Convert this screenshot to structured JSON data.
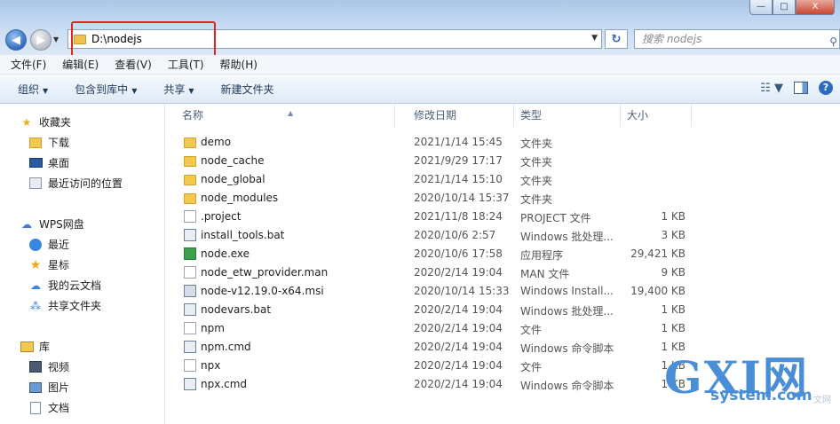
{
  "window": {
    "minimize": "—",
    "maximize": "□",
    "close": "X"
  },
  "address": {
    "path": "D:\\nodejs",
    "search_placeholder": "搜索 nodejs"
  },
  "menu": [
    "文件(F)",
    "编辑(E)",
    "查看(V)",
    "工具(T)",
    "帮助(H)"
  ],
  "commands": [
    {
      "label": "组织",
      "dropdown": true
    },
    {
      "label": "包含到库中",
      "dropdown": true
    },
    {
      "label": "共享",
      "dropdown": true
    },
    {
      "label": "新建文件夹",
      "dropdown": false
    }
  ],
  "nav": {
    "favorites": "收藏夹",
    "downloads": "下载",
    "desktop": "桌面",
    "recent_places": "最近访问的位置",
    "wps": "WPS网盘",
    "wps_recent": "最近",
    "wps_star": "星标",
    "wps_cloud": "我的云文档",
    "wps_shared": "共享文件夹",
    "library": "库",
    "videos": "视频",
    "pictures": "图片",
    "documents": "文档"
  },
  "columns": {
    "name": "名称",
    "modified": "修改日期",
    "type": "类型",
    "size": "大小"
  },
  "files": [
    {
      "name": "demo",
      "date": "2021/1/14 15:45",
      "type": "文件夹",
      "size": "",
      "icon": "folder"
    },
    {
      "name": "node_cache",
      "date": "2021/9/29 17:17",
      "type": "文件夹",
      "size": "",
      "icon": "folder"
    },
    {
      "name": "node_global",
      "date": "2021/1/14 15:10",
      "type": "文件夹",
      "size": "",
      "icon": "folder"
    },
    {
      "name": "node_modules",
      "date": "2020/10/14 15:37",
      "type": "文件夹",
      "size": "",
      "icon": "folder"
    },
    {
      "name": ".project",
      "date": "2021/11/8 18:24",
      "type": "PROJECT 文件",
      "size": "1 KB",
      "icon": "file"
    },
    {
      "name": "install_tools.bat",
      "date": "2020/10/6 2:57",
      "type": "Windows 批处理...",
      "size": "3 KB",
      "icon": "bat"
    },
    {
      "name": "node.exe",
      "date": "2020/10/6 17:58",
      "type": "应用程序",
      "size": "29,421 KB",
      "icon": "exe"
    },
    {
      "name": "node_etw_provider.man",
      "date": "2020/2/14 19:04",
      "type": "MAN 文件",
      "size": "9 KB",
      "icon": "file"
    },
    {
      "name": "node-v12.19.0-x64.msi",
      "date": "2020/10/14 15:33",
      "type": "Windows Install...",
      "size": "19,400 KB",
      "icon": "msi"
    },
    {
      "name": "nodevars.bat",
      "date": "2020/2/14 19:04",
      "type": "Windows 批处理...",
      "size": "1 KB",
      "icon": "bat"
    },
    {
      "name": "npm",
      "date": "2020/2/14 19:04",
      "type": "文件",
      "size": "1 KB",
      "icon": "file"
    },
    {
      "name": "npm.cmd",
      "date": "2020/2/14 19:04",
      "type": "Windows 命令脚本",
      "size": "1 KB",
      "icon": "bat"
    },
    {
      "name": "npx",
      "date": "2020/2/14 19:04",
      "type": "文件",
      "size": "1 KB",
      "icon": "file"
    },
    {
      "name": "npx.cmd",
      "date": "2020/2/14 19:04",
      "type": "Windows 命令脚本",
      "size": "1 KB",
      "icon": "bat"
    }
  ],
  "watermark": {
    "big": "GXI网",
    "small": "system.com",
    "tag": "文网"
  }
}
